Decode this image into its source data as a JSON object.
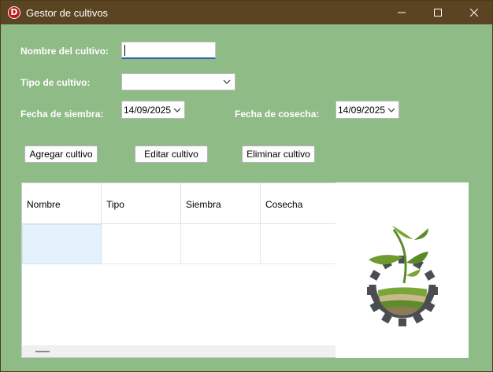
{
  "window": {
    "title": "Gestor de cultivos",
    "app_icon_letter": "D"
  },
  "form": {
    "nombre_label": "Nombre del cultivo:",
    "nombre_value": "",
    "tipo_label": "Tipo de cultivo:",
    "tipo_value": "",
    "siembra_label": "Fecha de siembra:",
    "siembra_value": "14/09/2025",
    "cosecha_label": "Fecha de cosecha:",
    "cosecha_value": "14/09/2025"
  },
  "buttons": {
    "agregar": "Agregar cultivo",
    "editar": "Editar cultivo",
    "eliminar": "Eliminar cultivo"
  },
  "grid": {
    "columns": [
      "Nombre",
      "Tipo",
      "Siembra",
      "Cosecha"
    ],
    "rows": [
      [
        "",
        "",
        "",
        ""
      ]
    ]
  },
  "colors": {
    "background": "#8fbb87",
    "titlebar": "#5b4421",
    "accent": "#2f64b6",
    "selected_cell": "#e5f1fb"
  },
  "icons": {
    "logo": "plant-gear-logo"
  }
}
